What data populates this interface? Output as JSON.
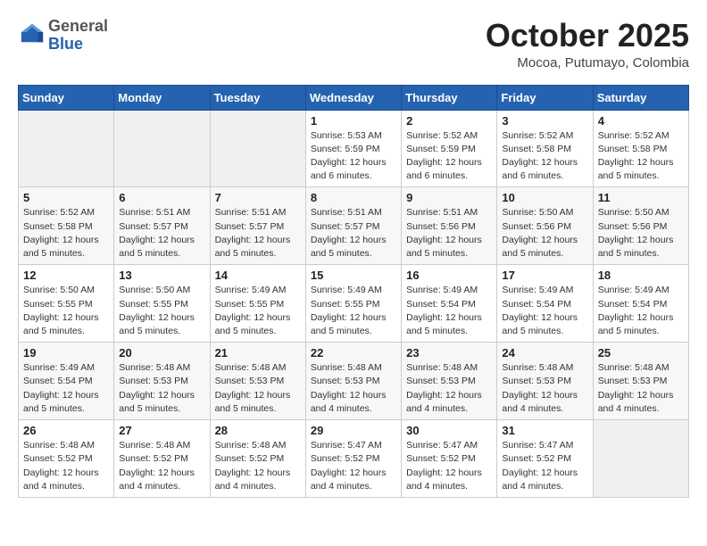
{
  "header": {
    "logo_general": "General",
    "logo_blue": "Blue",
    "month_title": "October 2025",
    "location": "Mocoa, Putumayo, Colombia"
  },
  "weekdays": [
    "Sunday",
    "Monday",
    "Tuesday",
    "Wednesday",
    "Thursday",
    "Friday",
    "Saturday"
  ],
  "weeks": [
    [
      {
        "day": "",
        "info": ""
      },
      {
        "day": "",
        "info": ""
      },
      {
        "day": "",
        "info": ""
      },
      {
        "day": "1",
        "info": "Sunrise: 5:53 AM\nSunset: 5:59 PM\nDaylight: 12 hours\nand 6 minutes."
      },
      {
        "day": "2",
        "info": "Sunrise: 5:52 AM\nSunset: 5:59 PM\nDaylight: 12 hours\nand 6 minutes."
      },
      {
        "day": "3",
        "info": "Sunrise: 5:52 AM\nSunset: 5:58 PM\nDaylight: 12 hours\nand 6 minutes."
      },
      {
        "day": "4",
        "info": "Sunrise: 5:52 AM\nSunset: 5:58 PM\nDaylight: 12 hours\nand 5 minutes."
      }
    ],
    [
      {
        "day": "5",
        "info": "Sunrise: 5:52 AM\nSunset: 5:58 PM\nDaylight: 12 hours\nand 5 minutes."
      },
      {
        "day": "6",
        "info": "Sunrise: 5:51 AM\nSunset: 5:57 PM\nDaylight: 12 hours\nand 5 minutes."
      },
      {
        "day": "7",
        "info": "Sunrise: 5:51 AM\nSunset: 5:57 PM\nDaylight: 12 hours\nand 5 minutes."
      },
      {
        "day": "8",
        "info": "Sunrise: 5:51 AM\nSunset: 5:57 PM\nDaylight: 12 hours\nand 5 minutes."
      },
      {
        "day": "9",
        "info": "Sunrise: 5:51 AM\nSunset: 5:56 PM\nDaylight: 12 hours\nand 5 minutes."
      },
      {
        "day": "10",
        "info": "Sunrise: 5:50 AM\nSunset: 5:56 PM\nDaylight: 12 hours\nand 5 minutes."
      },
      {
        "day": "11",
        "info": "Sunrise: 5:50 AM\nSunset: 5:56 PM\nDaylight: 12 hours\nand 5 minutes."
      }
    ],
    [
      {
        "day": "12",
        "info": "Sunrise: 5:50 AM\nSunset: 5:55 PM\nDaylight: 12 hours\nand 5 minutes."
      },
      {
        "day": "13",
        "info": "Sunrise: 5:50 AM\nSunset: 5:55 PM\nDaylight: 12 hours\nand 5 minutes."
      },
      {
        "day": "14",
        "info": "Sunrise: 5:49 AM\nSunset: 5:55 PM\nDaylight: 12 hours\nand 5 minutes."
      },
      {
        "day": "15",
        "info": "Sunrise: 5:49 AM\nSunset: 5:55 PM\nDaylight: 12 hours\nand 5 minutes."
      },
      {
        "day": "16",
        "info": "Sunrise: 5:49 AM\nSunset: 5:54 PM\nDaylight: 12 hours\nand 5 minutes."
      },
      {
        "day": "17",
        "info": "Sunrise: 5:49 AM\nSunset: 5:54 PM\nDaylight: 12 hours\nand 5 minutes."
      },
      {
        "day": "18",
        "info": "Sunrise: 5:49 AM\nSunset: 5:54 PM\nDaylight: 12 hours\nand 5 minutes."
      }
    ],
    [
      {
        "day": "19",
        "info": "Sunrise: 5:49 AM\nSunset: 5:54 PM\nDaylight: 12 hours\nand 5 minutes."
      },
      {
        "day": "20",
        "info": "Sunrise: 5:48 AM\nSunset: 5:53 PM\nDaylight: 12 hours\nand 5 minutes."
      },
      {
        "day": "21",
        "info": "Sunrise: 5:48 AM\nSunset: 5:53 PM\nDaylight: 12 hours\nand 5 minutes."
      },
      {
        "day": "22",
        "info": "Sunrise: 5:48 AM\nSunset: 5:53 PM\nDaylight: 12 hours\nand 4 minutes."
      },
      {
        "day": "23",
        "info": "Sunrise: 5:48 AM\nSunset: 5:53 PM\nDaylight: 12 hours\nand 4 minutes."
      },
      {
        "day": "24",
        "info": "Sunrise: 5:48 AM\nSunset: 5:53 PM\nDaylight: 12 hours\nand 4 minutes."
      },
      {
        "day": "25",
        "info": "Sunrise: 5:48 AM\nSunset: 5:53 PM\nDaylight: 12 hours\nand 4 minutes."
      }
    ],
    [
      {
        "day": "26",
        "info": "Sunrise: 5:48 AM\nSunset: 5:52 PM\nDaylight: 12 hours\nand 4 minutes."
      },
      {
        "day": "27",
        "info": "Sunrise: 5:48 AM\nSunset: 5:52 PM\nDaylight: 12 hours\nand 4 minutes."
      },
      {
        "day": "28",
        "info": "Sunrise: 5:48 AM\nSunset: 5:52 PM\nDaylight: 12 hours\nand 4 minutes."
      },
      {
        "day": "29",
        "info": "Sunrise: 5:47 AM\nSunset: 5:52 PM\nDaylight: 12 hours\nand 4 minutes."
      },
      {
        "day": "30",
        "info": "Sunrise: 5:47 AM\nSunset: 5:52 PM\nDaylight: 12 hours\nand 4 minutes."
      },
      {
        "day": "31",
        "info": "Sunrise: 5:47 AM\nSunset: 5:52 PM\nDaylight: 12 hours\nand 4 minutes."
      },
      {
        "day": "",
        "info": ""
      }
    ]
  ]
}
